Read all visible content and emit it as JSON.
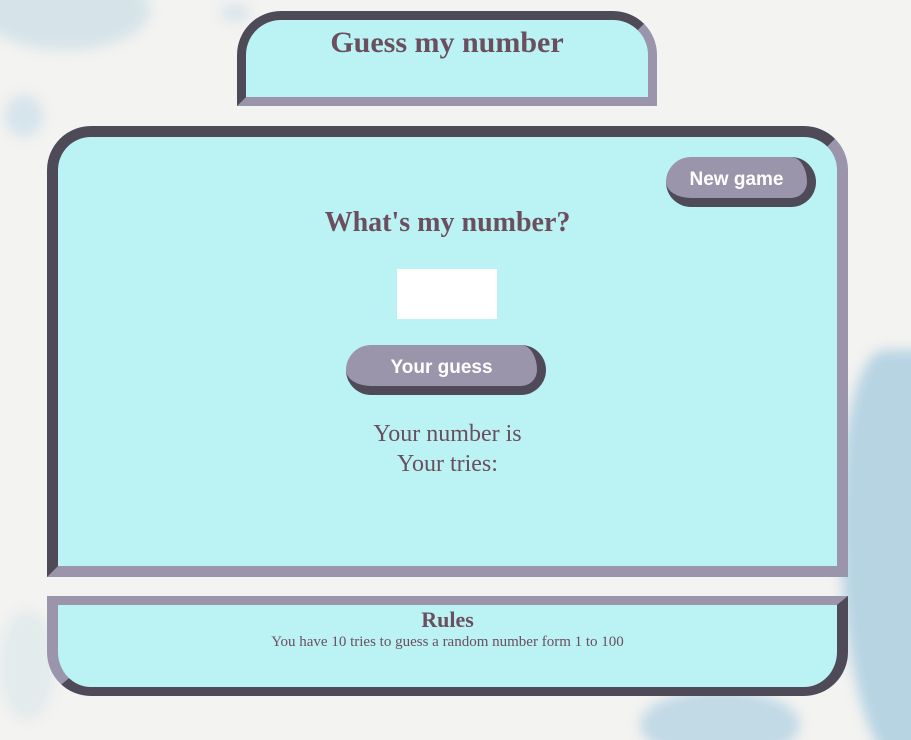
{
  "header": {
    "title": "Guess my number"
  },
  "game": {
    "new_game_label": "New game",
    "question": "What's my number?",
    "guess_input": {
      "value": "",
      "placeholder": ""
    },
    "guess_button_label": "Your guess",
    "number_status": "Your number is",
    "tries_status": "Your tries:"
  },
  "rules": {
    "title": "Rules",
    "text": "You have 10 tries to guess a random number form 1 to 100"
  },
  "colors": {
    "panel_background": "#bbf2f4",
    "border_dark": "#4f4a58",
    "border_light": "#9b95ac",
    "text": "#6b4f5e",
    "button_background": "#9b95ac",
    "page_background": "#f3f3f1"
  }
}
